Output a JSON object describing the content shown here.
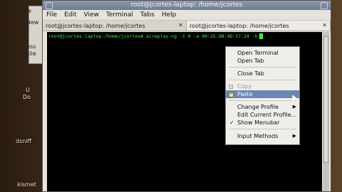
{
  "desktop": {
    "labels": [
      "e",
      "New",
      "bss",
      "clie",
      "U",
      "Do",
      "dsniff",
      "kismet"
    ]
  },
  "window": {
    "title": "root@jcortes-laptop: /home/jcortes",
    "menu": [
      "File",
      "Edit",
      "View",
      "Terminal",
      "Tabs",
      "Help"
    ],
    "tabs": [
      {
        "label": "root@jcortes-laptop: /home/jcortes"
      },
      {
        "label": "root@jcortes-laptop: /home/jcortes"
      }
    ],
    "command": "root@jcortes-laptop:/home/jcortes# aireplay-ng -1 0 -a 00:25:9B:4D:17:24 -h"
  },
  "context_menu": {
    "items": [
      {
        "label": "Open Terminal"
      },
      {
        "label": "Open Tab"
      },
      {
        "label": "Close Tab"
      },
      {
        "label": "Copy"
      },
      {
        "label": "Paste"
      },
      {
        "label": "Change Profile"
      },
      {
        "label": "Edit Current Profile..."
      },
      {
        "label": "Show Menubar"
      },
      {
        "label": "Input Methods"
      }
    ]
  },
  "colors": {
    "terminal_text": "#46e846",
    "highlight": "#6a86b3"
  }
}
